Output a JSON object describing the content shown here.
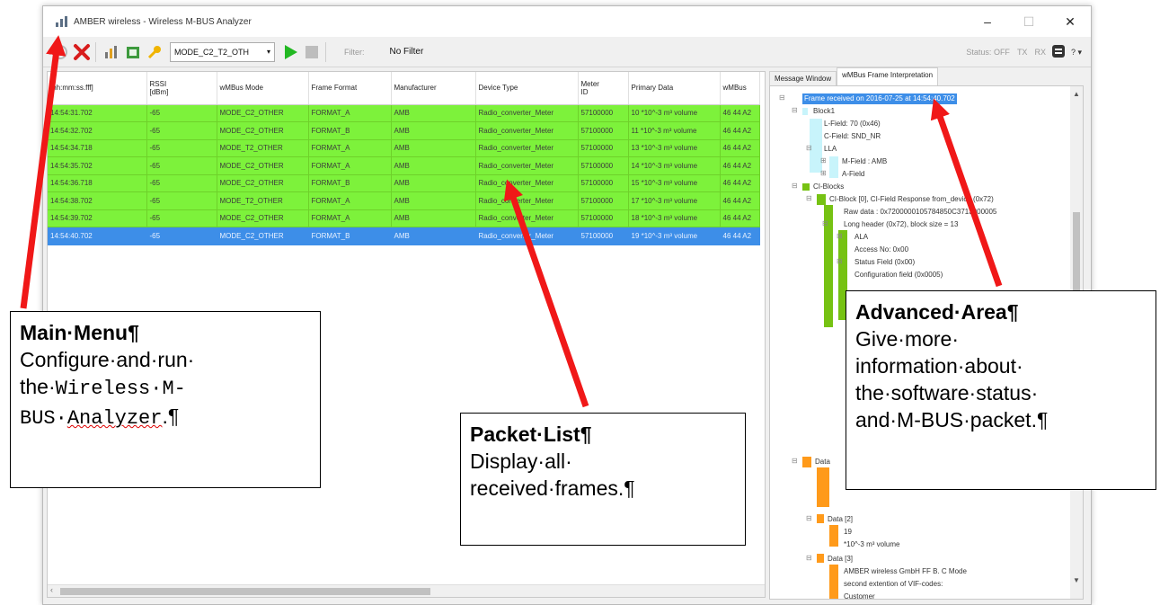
{
  "window": {
    "title": "AMBER wireless - Wireless M-BUS Analyzer",
    "min": "–",
    "max": "☐",
    "close": "✕"
  },
  "toolbar": {
    "mode": "MODE_C2_T2_OTH",
    "filter_label": "Filter:",
    "filter_value": "No Filter",
    "status": "Status: OFF",
    "tx": "TX",
    "rx": "RX",
    "help": "? ▾"
  },
  "packet_list": {
    "columns": [
      "[hh:mm:ss.fff]",
      "RSSI\n[dBm]",
      "wMBus Mode",
      "Frame Format",
      "Manufacturer",
      "Device Type",
      "Meter\nID",
      "Primary Data",
      "wMBus"
    ],
    "rows": [
      [
        "14:54:31.702",
        "-65",
        "MODE_C2_OTHER",
        "FORMAT_A",
        "AMB",
        "Radio_converter_Meter",
        "57100000",
        "10 *10^-3 m³ volume",
        "46 44 A2"
      ],
      [
        "14:54:32.702",
        "-65",
        "MODE_C2_OTHER",
        "FORMAT_B",
        "AMB",
        "Radio_converter_Meter",
        "57100000",
        "11 *10^-3 m³ volume",
        "46 44 A2"
      ],
      [
        "14:54:34.718",
        "-65",
        "MODE_T2_OTHER",
        "FORMAT_A",
        "AMB",
        "Radio_converter_Meter",
        "57100000",
        "13 *10^-3 m³ volume",
        "46 44 A2"
      ],
      [
        "14:54:35.702",
        "-65",
        "MODE_C2_OTHER",
        "FORMAT_A",
        "AMB",
        "Radio_converter_Meter",
        "57100000",
        "14 *10^-3 m³ volume",
        "46 44 A2"
      ],
      [
        "14:54:36.718",
        "-65",
        "MODE_C2_OTHER",
        "FORMAT_B",
        "AMB",
        "Radio_converter_Meter",
        "57100000",
        "15 *10^-3 m³ volume",
        "46 44 A2"
      ],
      [
        "14:54:38.702",
        "-65",
        "MODE_T2_OTHER",
        "FORMAT_A",
        "AMB",
        "Radio_converter_Meter",
        "57100000",
        "17 *10^-3 m³ volume",
        "46 44 A2"
      ],
      [
        "14:54:39.702",
        "-65",
        "MODE_C2_OTHER",
        "FORMAT_A",
        "AMB",
        "Radio_converter_Meter",
        "57100000",
        "18 *10^-3 m³ volume",
        "46 44 A2"
      ],
      [
        "14:54:40.702",
        "-65",
        "MODE_C2_OTHER",
        "FORMAT_B",
        "AMB",
        "Radio_converter_Meter",
        "57100000",
        "19 *10^-3 m³ volume",
        "46 44 A2"
      ]
    ],
    "selected_row": 7
  },
  "advanced": {
    "tabs": [
      "Message Window",
      "wMBus Frame Interpretation"
    ],
    "tree": {
      "root": "Frame received on 2016-07-25 at 14:54:40.702",
      "block1": "Block1",
      "l_field": "L-Field: 70 (0x46)",
      "c_field": "C-Field: SND_NR",
      "lla": "LLA",
      "m_field": "M-Field : AMB",
      "a_field": "A-Field",
      "ci_blocks": "CI-Blocks",
      "ci_block0": "CI-Block [0], CI-Field Response from_device (0x72)",
      "raw_data": "Raw data : 0x7200000105784850C3713000005",
      "long_header": "Long header (0x72), block size = 13",
      "ala": "ALA",
      "access_no": "Access No: 0x00",
      "status_field": "Status Field (0x00)",
      "config_field": "Configuration field (0x0005)",
      "data": "Data",
      "data2": "Data [2]",
      "data2_val": "19",
      "data2_unit": "*10^-3 m³ volume",
      "data3": "Data [3]",
      "data3_val1": "AMBER wireless GmbH FF B. C Mode",
      "data3_val2": "second extention of VIF-codes:",
      "data3_val3": "Customer"
    }
  },
  "callouts": {
    "main_menu": {
      "heading": "Main·Menu¶",
      "line1": "Configure·and·run·",
      "line2a": "the·",
      "line2b": "Wireless·M-",
      "line3a": "BUS·",
      "line3b": "Analyzer",
      "line3c": ".¶"
    },
    "packet_list": {
      "heading": "Packet·List¶",
      "line1": "Display·all·",
      "line2": "received·frames.¶"
    },
    "advanced_area": {
      "heading": "Advanced·Area¶",
      "line1": "Give·more·",
      "line2": "information·about·",
      "line3": "the·software·status·",
      "line4": "and·M-BUS·packet.¶"
    }
  },
  "colors": {
    "row_green": "#7df23b",
    "row_selected": "#3d8ee8",
    "arrow_red": "#f01818",
    "block_cyan": "#c8f4fb",
    "block_green": "#76c213",
    "block_orange": "#ff9a1a"
  }
}
